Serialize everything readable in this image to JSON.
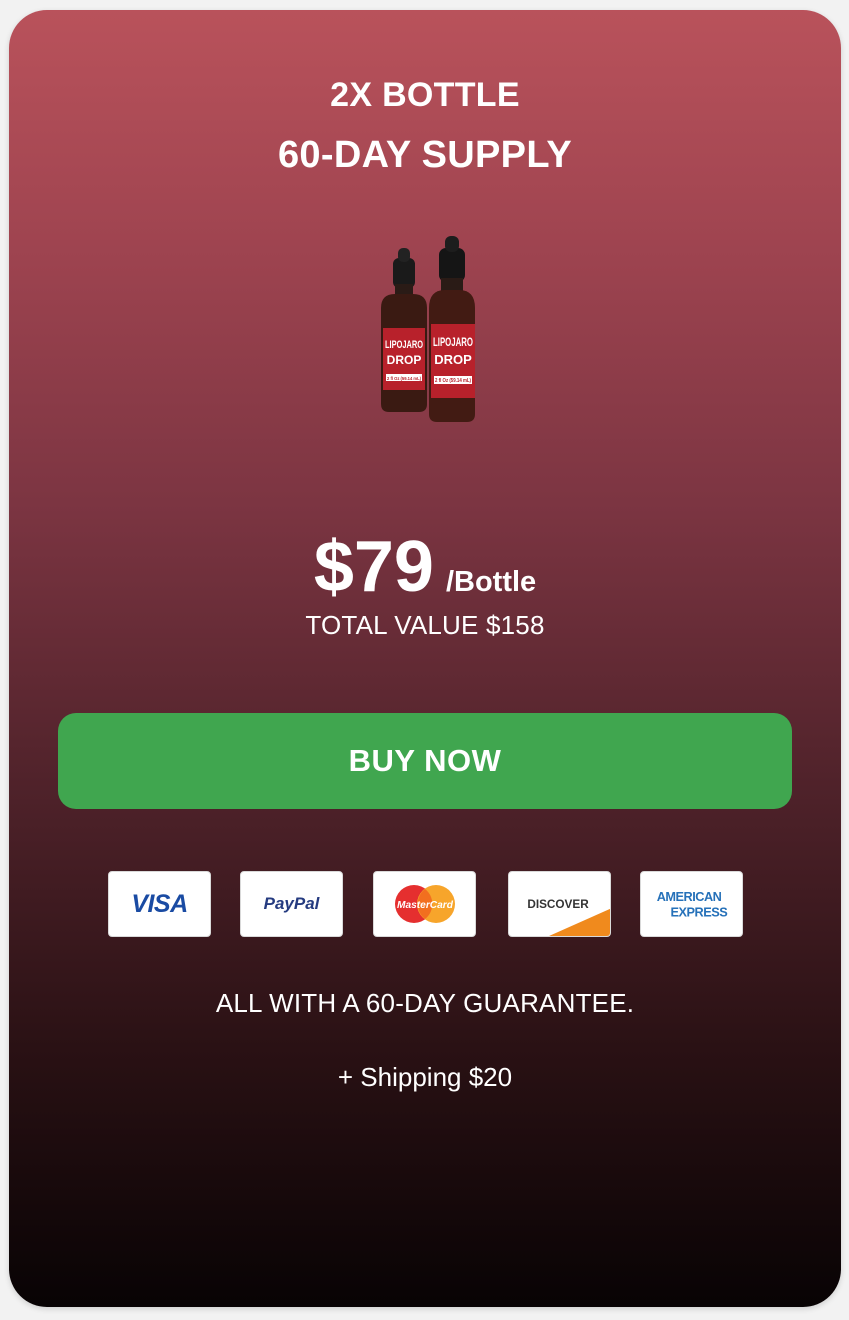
{
  "package": {
    "quantity_label": "2X BOTTLE",
    "supply_label": "60-DAY SUPPLY"
  },
  "product": {
    "label_line1": "LIPOJARO",
    "label_line2": "DROP",
    "volume_label": "2 fl Oz (59.14 mL)",
    "brand_color": "#b8212b"
  },
  "pricing": {
    "price": "$79",
    "unit": "/Bottle",
    "total_value": "TOTAL VALUE $158"
  },
  "cta": {
    "label": "BUY NOW",
    "color": "#40a64f"
  },
  "payment_methods": [
    {
      "name": "VISA",
      "icon": "visa-icon"
    },
    {
      "name": "PayPal",
      "icon": "paypal-icon"
    },
    {
      "name": "MasterCard",
      "icon": "mastercard-icon"
    },
    {
      "name": "DISCOVER",
      "icon": "discover-icon"
    },
    {
      "name": "AMERICAN",
      "name2": "EXPRESS",
      "icon": "amex-icon"
    }
  ],
  "guarantee": "ALL WITH A 60-DAY GUARANTEE.",
  "shipping": "+ Shipping $20"
}
